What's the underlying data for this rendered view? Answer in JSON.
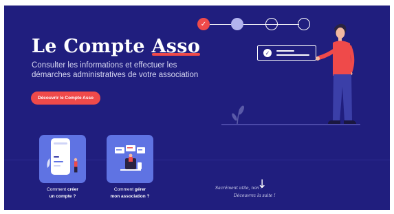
{
  "hero": {
    "title_main": "Le Compte ",
    "title_accent": "Asso",
    "subtitle": "Consulter les informations et effectuer les démarches administratives de votre association",
    "cta_label": "Découvrir le Compte Asso"
  },
  "stepper": {
    "steps": [
      {
        "state": "done",
        "icon": "checkmark-icon",
        "glyph": "✓"
      },
      {
        "state": "active"
      },
      {
        "state": "todo"
      },
      {
        "state": "todo"
      }
    ]
  },
  "check_card": {
    "glyph": "✓"
  },
  "cards": [
    {
      "prefix": "Comment ",
      "bold": "créer",
      "line2": "un compte ?",
      "icon": "phone-illustration"
    },
    {
      "prefix": "Comment ",
      "bold": "gérer",
      "line2": "mon association ?",
      "icon": "meeting-illustration"
    }
  ],
  "scroll_hint": {
    "line1": "Sacrément utile, non ?",
    "line2": "Découvrez la suite !",
    "arrow": "↓"
  },
  "colors": {
    "background": "#201e7e",
    "accent": "#ef4a4a",
    "card": "#5f73e3",
    "step_active": "#b2b3ee"
  }
}
